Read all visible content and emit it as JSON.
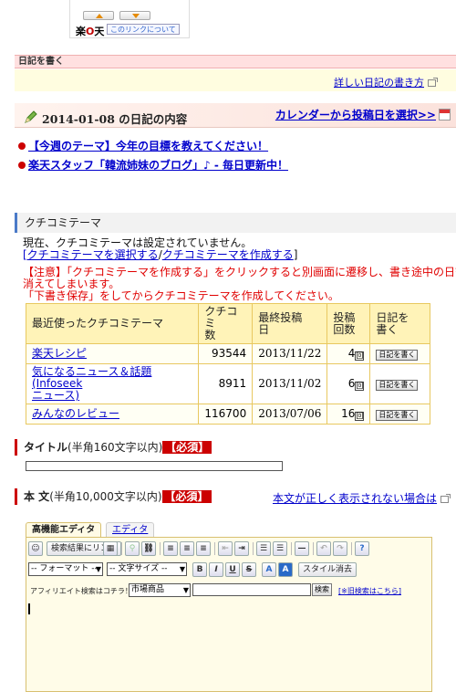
{
  "widget": {
    "logo_text": "楽",
    "logo_mark": "O",
    "logo_text2": "天",
    "about_link": "このリンクについて"
  },
  "write_bar": {
    "label": "日記を書く"
  },
  "howto": {
    "link": "詳しい日記の書き方"
  },
  "date_head": {
    "title": "2014-01-08 の日記の内容",
    "calendar_link": "カレンダーから投稿日を選択>>"
  },
  "topics": [
    {
      "label": "【今週のテーマ】今年の目標を教えてください！"
    },
    {
      "label": "楽天スタッフ「韓流姉妹のブログ」♪ - 毎日更新中！"
    }
  ],
  "kuchikomi": {
    "heading": "クチコミテーマ",
    "status_line": "現在、クチコミテーマは設定されていません。",
    "select_link": "[クチコミテーマを選択する",
    "slash": "/",
    "create_link": "クチコミテーマを作成する",
    "close_bracket": "]",
    "notice_1": "【注意】「クチコミテーマを作成する」をクリックすると別画面に遷移し、書き途中の日記が",
    "notice_2": "消えてしまいます。",
    "notice_3": "「下書き保存」をしてからクチコミテーマを作成してください。",
    "table": {
      "headers": {
        "theme": "最近使ったクチコミテーマ",
        "count_1": "クチコミ",
        "count_2": "数",
        "last_1": "最終投稿",
        "last_2": "日",
        "times_1": "投稿",
        "times_2": "回数",
        "write_1": "日記を",
        "write_2": "書く"
      },
      "rows": [
        {
          "theme": "楽天レシピ",
          "theme_2": "",
          "count": "93544",
          "last": "2013/11/22",
          "times": "4",
          "times_unit": "回",
          "write": "日記を書く"
        },
        {
          "theme": "気になるニュース＆話題(Infoseek",
          "theme_2": "ニュース)",
          "count": "8911",
          "last": "2013/11/02",
          "times": "6",
          "times_unit": "回",
          "write": "日記を書く"
        },
        {
          "theme": "みんなのレビュー",
          "theme_2": "",
          "count": "116700",
          "last": "2013/07/06",
          "times": "16",
          "times_unit": "回",
          "write": "日記を書く"
        }
      ]
    }
  },
  "title_field": {
    "label": "タイトル",
    "hint": "(半角160文字以内)",
    "required": "【必須】",
    "value": ""
  },
  "body_field": {
    "label": "本 文",
    "hint": "(半角10,000文字以内)",
    "required": "【必須】",
    "help_link": "本文が正しく表示されない場合は"
  },
  "editor": {
    "tab_advanced": "高機能エディタ",
    "tab_simple": "エディタ",
    "search_link_btn": "検索結果にリンク",
    "format_select": "-- フォーマット --",
    "size_select": "-- 文字サイズ --",
    "bold": "B",
    "italic": "I",
    "underline": "U",
    "strike": "S",
    "font_a": "A",
    "bg_a": "A",
    "style_clear": "スタイル消去",
    "affiliate_label": "アフィリエイト検索はコチラ！",
    "affiliate_select": "市場商品",
    "search_btn": "検索",
    "old_search_link": "[※旧検索はこちら]",
    "body_value": ""
  },
  "colors": {
    "link": "#0000cc",
    "required_bg": "#cc0000",
    "warning": "#e00000",
    "table_header": "#fff3b8",
    "write_bar_bg": "#ffe0e0"
  }
}
